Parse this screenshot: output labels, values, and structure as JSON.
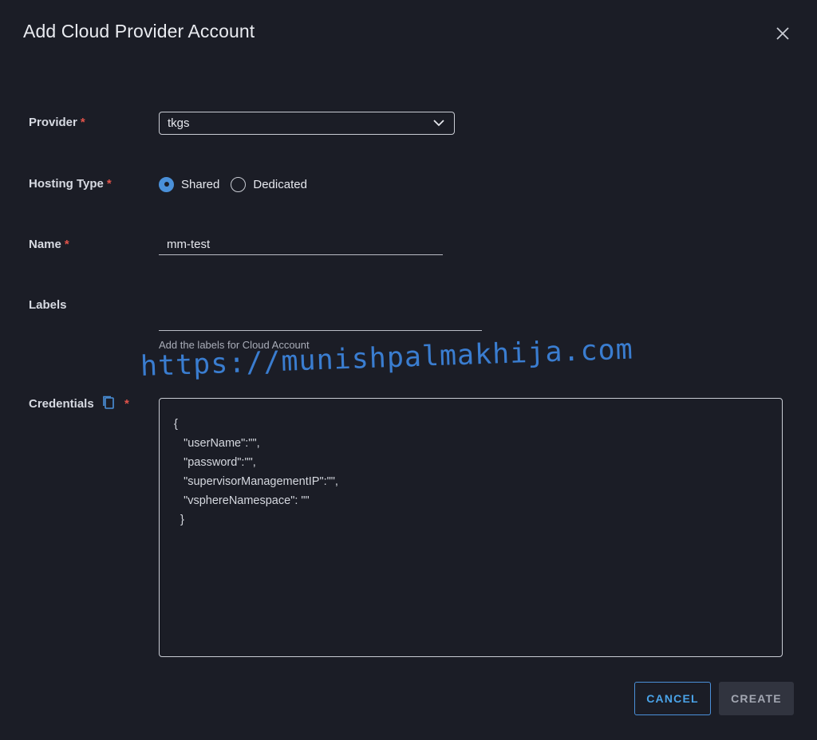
{
  "dialog": {
    "title": "Add Cloud Provider Account"
  },
  "form": {
    "provider": {
      "label": "Provider",
      "value": "tkgs"
    },
    "hosting_type": {
      "label": "Hosting Type",
      "options": [
        "Shared",
        "Dedicated"
      ],
      "selected": "Shared"
    },
    "name": {
      "label": "Name",
      "value": "mm-test"
    },
    "labels": {
      "label": "Labels",
      "value": "",
      "helper": "Add the labels for Cloud Account"
    },
    "credentials": {
      "label": "Credentials",
      "value": "{\n   \"userName\":\"\",\n   \"password\":\"\",\n   \"supervisorManagementIP\":\"\",\n   \"vsphereNamespace\": \"\"\n  }"
    },
    "required_marker": "*"
  },
  "watermark": "https://munishpalmakhija.com",
  "actions": {
    "cancel": "CANCEL",
    "create": "CREATE"
  },
  "colors": {
    "accent": "#4a90d9",
    "required": "#e2534a",
    "background": "#1b1d26"
  }
}
